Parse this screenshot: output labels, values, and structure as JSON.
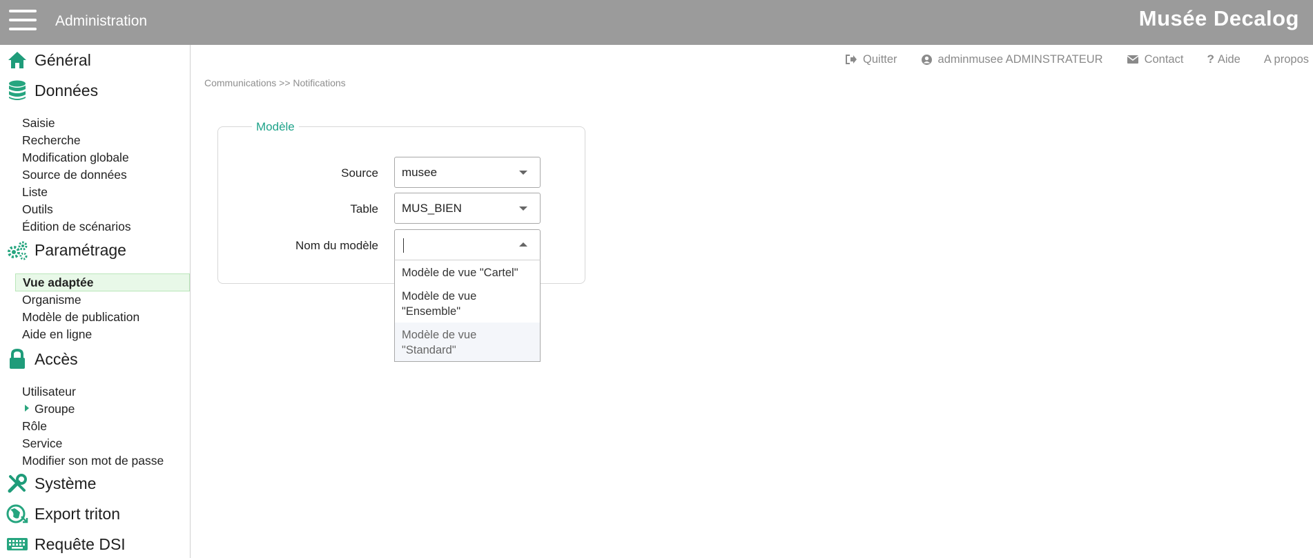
{
  "header": {
    "app_title": "Administration",
    "brand": "Musée Decalog"
  },
  "sidebar": {
    "sections": [
      {
        "label": "Général",
        "icon": "home-icon"
      },
      {
        "label": "Données",
        "icon": "database-icon"
      },
      {
        "label": "Paramétrage",
        "icon": "gears-icon"
      },
      {
        "label": "Accès",
        "icon": "lock-icon"
      },
      {
        "label": "Système",
        "icon": "wrench-icon"
      },
      {
        "label": "Export triton",
        "icon": "globe-export-icon"
      },
      {
        "label": "Requête DSI",
        "icon": "keyboard-icon"
      }
    ],
    "donnees_items": [
      "Saisie",
      "Recherche",
      "Modification globale",
      "Source de données",
      "Liste",
      "Outils",
      "Édition de scénarios"
    ],
    "parametrage_items": [
      "Vue adaptée",
      "Organisme",
      "Modèle de publication",
      "Aide en ligne"
    ],
    "acces_items": [
      "Utilisateur",
      "Groupe",
      "Rôle",
      "Service",
      "Modifier son mot de passe"
    ]
  },
  "toplinks": {
    "quit": "Quitter",
    "user": "adminmusee ADMINSTRATEUR",
    "contact": "Contact",
    "help": "Aide",
    "about": "A propos"
  },
  "breadcrumb": "Communications >> Notifications",
  "form": {
    "legend": "Modèle",
    "source_label": "Source",
    "source_value": "musee",
    "table_label": "Table",
    "table_value": "MUS_BIEN",
    "model_label": "Nom du modèle",
    "model_value": "",
    "options": [
      "Modèle de vue \"Cartel\"",
      "Modèle de vue \"Ensemble\"",
      "Modèle de vue \"Standard\""
    ]
  },
  "colors": {
    "topbar": "#9b9b9b",
    "accent": "#1fa38a",
    "active_bg": "#e8f8e8"
  }
}
